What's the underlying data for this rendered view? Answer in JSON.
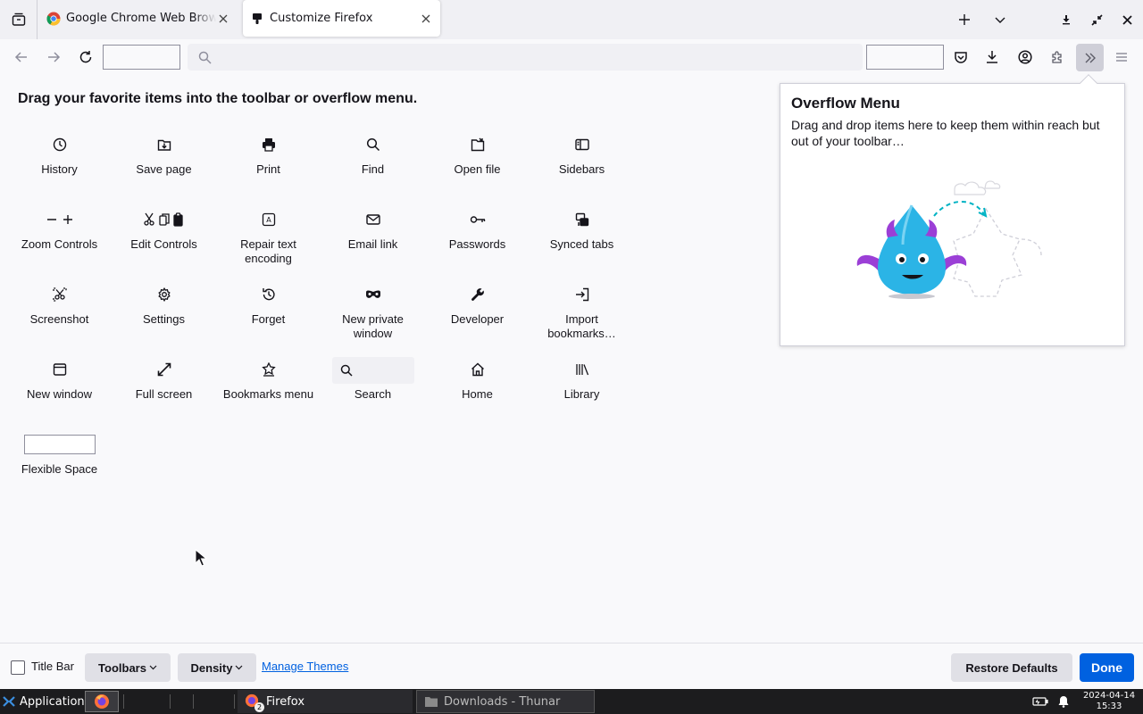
{
  "tabs": [
    {
      "title": "Google Chrome Web Browser",
      "active": false
    },
    {
      "title": "Customize Firefox",
      "active": true
    }
  ],
  "heading": "Drag your favorite items into the toolbar or overflow menu.",
  "palette": [
    {
      "label": "History",
      "icon": "history-icon"
    },
    {
      "label": "Save page",
      "icon": "save-page-icon"
    },
    {
      "label": "Print",
      "icon": "print-icon"
    },
    {
      "label": "Find",
      "icon": "find-icon"
    },
    {
      "label": "Open file",
      "icon": "open-file-icon"
    },
    {
      "label": "Sidebars",
      "icon": "sidebars-icon"
    },
    {
      "label": "Zoom Controls",
      "icon": "zoom-controls-icon"
    },
    {
      "label": "Edit Controls",
      "icon": "edit-controls-icon"
    },
    {
      "label": "Repair text encoding",
      "icon": "text-encoding-icon"
    },
    {
      "label": "Email link",
      "icon": "email-icon"
    },
    {
      "label": "Passwords",
      "icon": "key-icon"
    },
    {
      "label": "Synced tabs",
      "icon": "synced-tabs-icon"
    },
    {
      "label": "Screenshot",
      "icon": "screenshot-icon"
    },
    {
      "label": "Settings",
      "icon": "gear-icon"
    },
    {
      "label": "Forget",
      "icon": "forget-icon"
    },
    {
      "label": "New private window",
      "icon": "private-mask-icon"
    },
    {
      "label": "Developer",
      "icon": "wrench-icon"
    },
    {
      "label": "Import bookmarks…",
      "icon": "import-icon"
    },
    {
      "label": "New window",
      "icon": "new-window-icon"
    },
    {
      "label": "Full screen",
      "icon": "fullscreen-icon"
    },
    {
      "label": "Bookmarks menu",
      "icon": "bookmark-star-icon"
    },
    {
      "label": "Search",
      "icon": "search-icon"
    },
    {
      "label": "Home",
      "icon": "home-icon"
    },
    {
      "label": "Library",
      "icon": "library-icon"
    },
    {
      "label": "Flexible Space",
      "icon": "flexible-space"
    }
  ],
  "overflow": {
    "title": "Overflow Menu",
    "description": "Drag and drop items here to keep them within reach but out of your toolbar…"
  },
  "bottom": {
    "title_bar_label": "Title Bar",
    "toolbars_label": "Toolbars",
    "density_label": "Density",
    "manage_themes_label": "Manage Themes",
    "restore_label": "Restore Defaults",
    "done_label": "Done"
  },
  "taskbar": {
    "applications_label": "Applications",
    "firefox_task": "Firefox",
    "firefox_count": "2",
    "thunar_task": "Downloads - Thunar",
    "date": "2024-04-14",
    "time": "15:33"
  },
  "colors": {
    "accent": "#0061e0",
    "taskbar": "#1c1c1e",
    "tabstrip": "#f0f0f4"
  }
}
